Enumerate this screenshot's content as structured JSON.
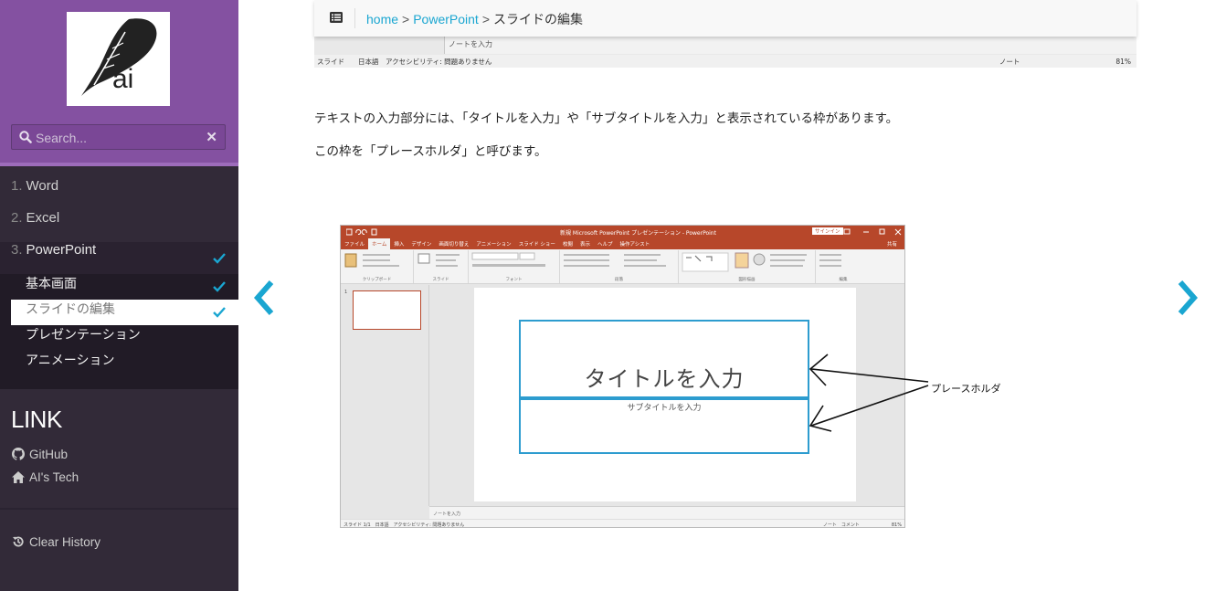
{
  "sidebar": {
    "search_placeholder": "Search...",
    "search_clear": "✕",
    "menu": [
      {
        "num": "1.",
        "label": "Word"
      },
      {
        "num": "2.",
        "label": "Excel"
      },
      {
        "num": "3.",
        "label": "PowerPoint"
      }
    ],
    "submenu": [
      {
        "label": "基本画面"
      },
      {
        "label": "スライドの編集"
      },
      {
        "label": "プレゼンテーション"
      },
      {
        "label": "アニメーション"
      }
    ],
    "link_title": "LINK",
    "links": [
      {
        "label": "GitHub",
        "icon": "github-icon"
      },
      {
        "label": "AI's Tech",
        "icon": "home-icon"
      }
    ],
    "clear_history": "Clear History",
    "logo_text": "ai",
    "accent_color": "#8451a1",
    "check_color": "#1aa6d1"
  },
  "topbar": {
    "breadcrumb": {
      "home": "home",
      "sep": ">",
      "section": "PowerPoint",
      "current": "スライドの編集"
    }
  },
  "prev_image": {
    "notes": "ノートを入力",
    "status_left": "スライド　　日本語　アクセシビリティ: 問題ありません",
    "status_right": "ノート　　　　　　　　　　　　　　81%"
  },
  "content": {
    "para1": "テキストの入力部分には、「タイトルを入力」や「サブタイトルを入力」と表示されている枠があります。",
    "para2": "この枠を「プレースホルダ」と呼びます。"
  },
  "ppt": {
    "window_title": "新規 Microsoft PowerPoint プレゼンテーション - PowerPoint",
    "signin": "サインイン",
    "tabs": [
      "ファイル",
      "ホーム",
      "挿入",
      "デザイン",
      "画面切り替え",
      "アニメーション",
      "スライド ショー",
      "校閲",
      "表示",
      "ヘルプ",
      "操作アシスト"
    ],
    "share": "共有",
    "groups": [
      "クリップボード",
      "スライド",
      "フォント",
      "段落",
      "図形描画",
      "編集"
    ],
    "slide_number": "1",
    "title_placeholder": "タイトルを入力",
    "subtitle_placeholder": "サブタイトルを入力",
    "notes": "ノートを入力",
    "status_left": "スライド 1/1　日本語　アクセシビリティ: 問題ありません",
    "status_right": "ノート　コメント　　　　　　　81%"
  },
  "annotation": {
    "label": "プレースホルダ"
  }
}
